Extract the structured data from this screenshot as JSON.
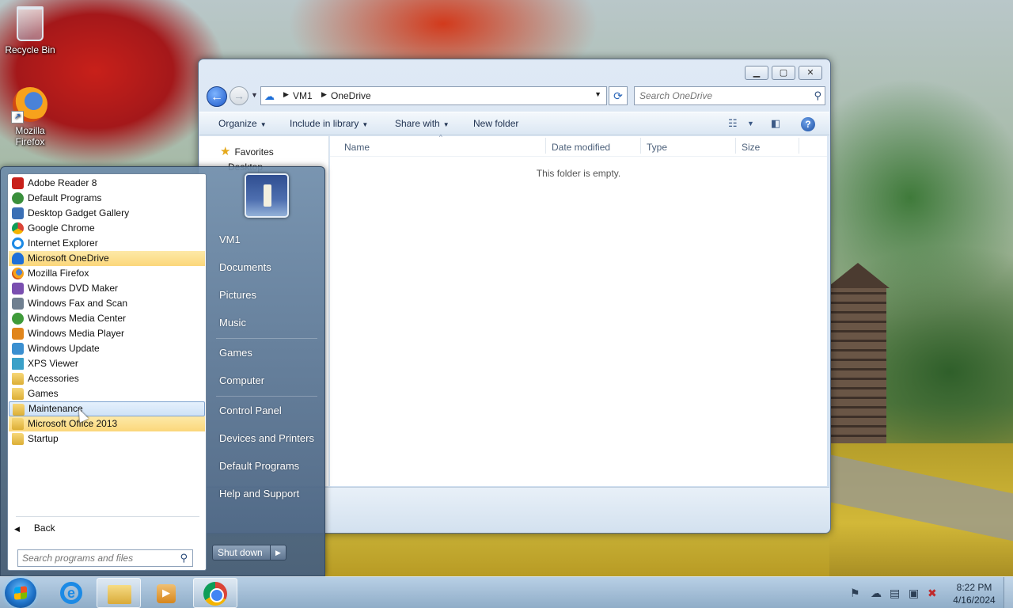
{
  "desktop": {
    "icons": [
      {
        "label": "Recycle Bin",
        "icon": "recycle-bin-icon"
      },
      {
        "label": "Mozilla Firefox",
        "icon": "firefox-icon"
      }
    ]
  },
  "explorer": {
    "breadcrumb": [
      "VM1",
      "OneDrive"
    ],
    "search_placeholder": "Search OneDrive",
    "toolbar": {
      "organize": "Organize",
      "include_in_library": "Include in library",
      "share_with": "Share with",
      "new_folder": "New folder"
    },
    "nav": {
      "favorites": "Favorites",
      "desktop": "Desktop"
    },
    "columns": [
      "Name",
      "Date modified",
      "Type",
      "Size"
    ],
    "empty_message": "This folder is empty."
  },
  "start_menu": {
    "programs": [
      {
        "label": "Adobe Reader 8",
        "color": "#c8201a"
      },
      {
        "label": "Default Programs",
        "color": "#3a8f3c"
      },
      {
        "label": "Desktop Gadget Gallery",
        "color": "#3a6fb5"
      },
      {
        "label": "Google Chrome",
        "color": "#db4437"
      },
      {
        "label": "Internet Explorer",
        "color": "#1c8ae5"
      },
      {
        "label": "Microsoft OneDrive",
        "color": "#1e6fd8"
      },
      {
        "label": "Mozilla Firefox",
        "color": "#e86a1c"
      },
      {
        "label": "Windows DVD Maker",
        "color": "#7a4fb0"
      },
      {
        "label": "Windows Fax and Scan",
        "color": "#6f7f90"
      },
      {
        "label": "Windows Media Center",
        "color": "#3f9b3a"
      },
      {
        "label": "Windows Media Player",
        "color": "#e0851c"
      },
      {
        "label": "Windows Update",
        "color": "#3a8fd0"
      },
      {
        "label": "XPS Viewer",
        "color": "#3aa0c8"
      },
      {
        "label": "Accessories",
        "color": "folder"
      },
      {
        "label": "Games",
        "color": "folder"
      },
      {
        "label": "Maintenance",
        "color": "folder"
      },
      {
        "label": "Microsoft Office 2013",
        "color": "folder"
      },
      {
        "label": "Startup",
        "color": "folder"
      }
    ],
    "back": "Back",
    "search_placeholder": "Search programs and files",
    "right_items": [
      "VM1",
      "Documents",
      "Pictures",
      "Music",
      "Games",
      "Computer",
      "Control Panel",
      "Devices and Printers",
      "Default Programs",
      "Help and Support"
    ],
    "shutdown": "Shut down"
  },
  "taskbar": {
    "time": "8:22 PM",
    "date": "4/16/2024"
  }
}
